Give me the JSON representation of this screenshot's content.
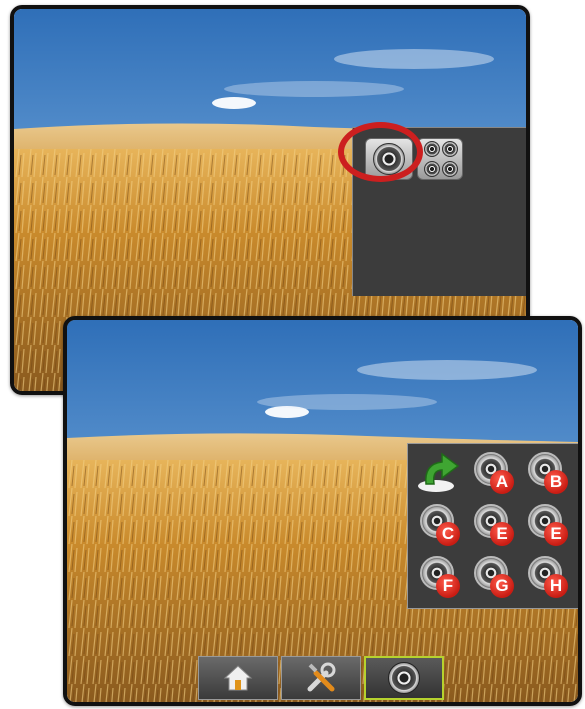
{
  "screens": {
    "top": {
      "scene": "wheat-field",
      "camera_panel": {
        "buttons": [
          {
            "name": "single-camera-view",
            "icon": "camera-lens-icon",
            "highlighted": true
          },
          {
            "name": "multi-camera-view",
            "icon": "quad-camera-icon",
            "highlighted": false
          }
        ],
        "highlight_color": "#cc1f1f"
      }
    },
    "bottom": {
      "scene": "wheat-field",
      "camera_selector": {
        "back_icon": "return-arrow-icon",
        "cameras": [
          {
            "label": "A"
          },
          {
            "label": "B"
          },
          {
            "label": "C"
          },
          {
            "label": "E"
          },
          {
            "label": "E"
          },
          {
            "label": "F"
          },
          {
            "label": "G"
          },
          {
            "label": "H"
          }
        ],
        "badge_color": "#d42a1e"
      },
      "toolbar": {
        "buttons": [
          {
            "icon": "home-icon",
            "active": false
          },
          {
            "icon": "tools-icon",
            "active": false
          },
          {
            "icon": "camera-icon",
            "active": true
          }
        ],
        "active_color": "#b6d22e"
      }
    }
  }
}
